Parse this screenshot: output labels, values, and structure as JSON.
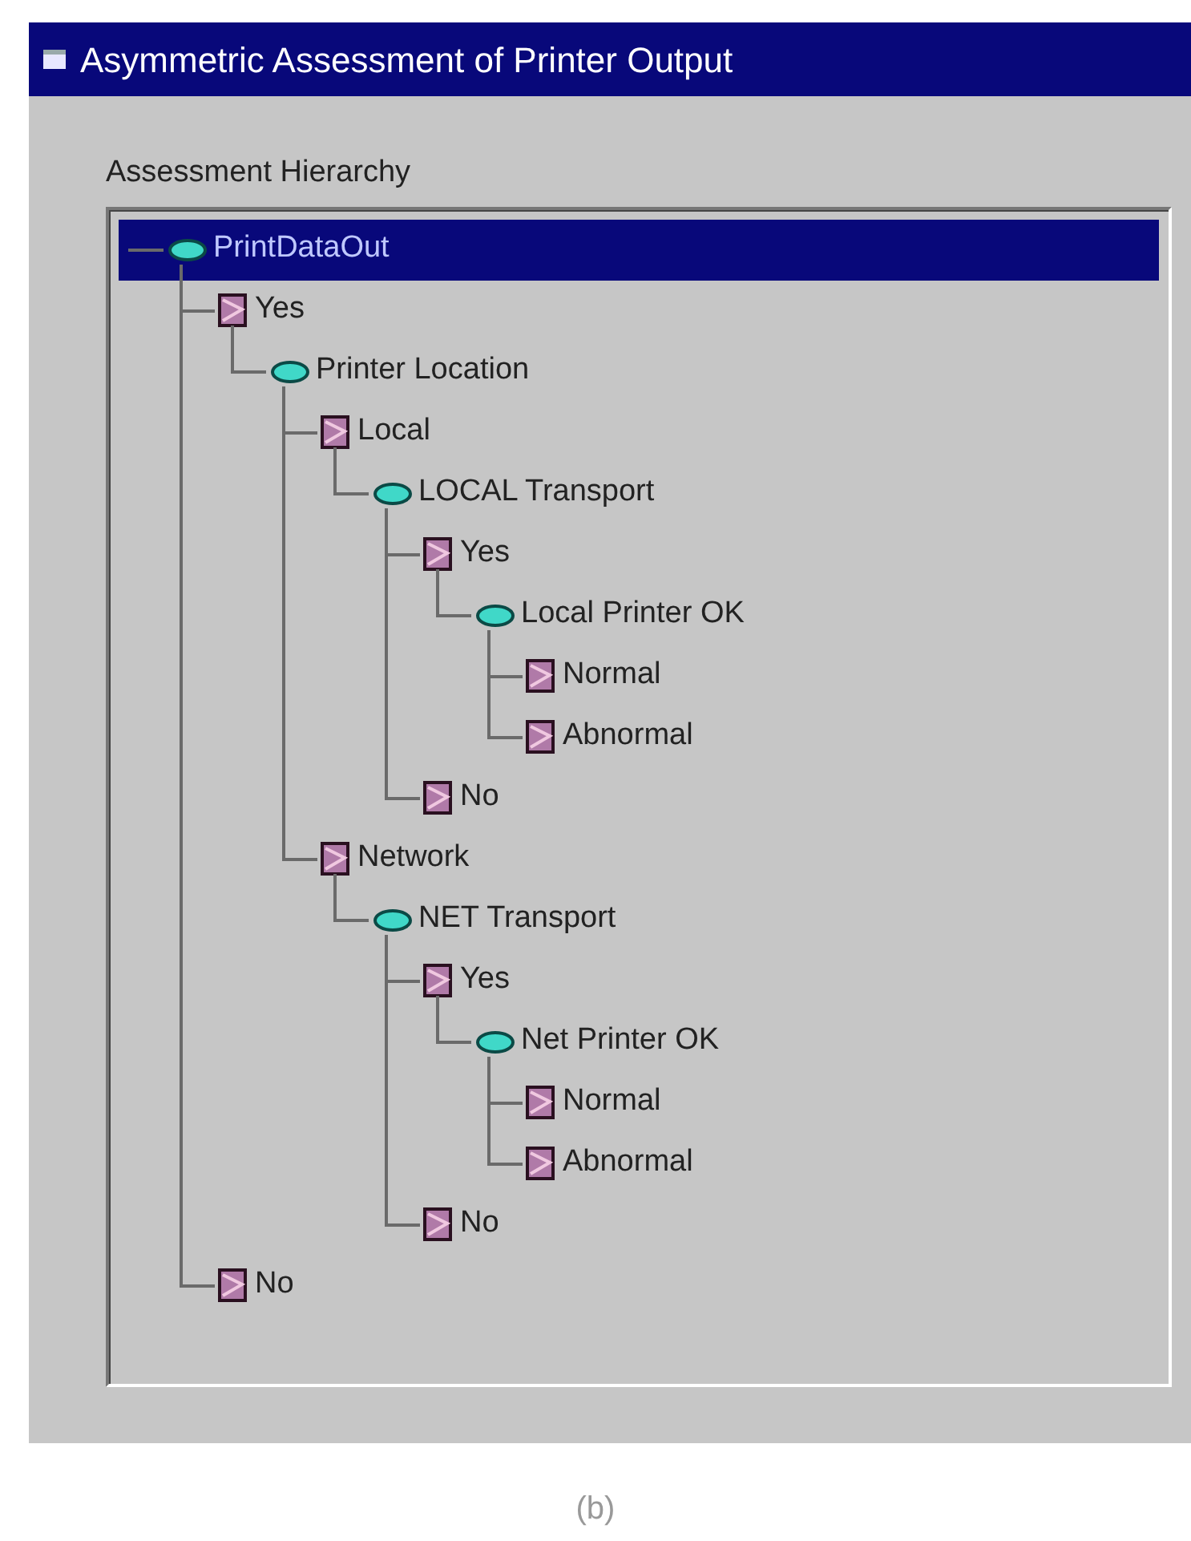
{
  "window": {
    "title": "Asymmetric Assessment of Printer Output"
  },
  "hierarchy": {
    "label": "Assessment Hierarchy",
    "tree": [
      {
        "label": "PrintDataOut",
        "kind": "variable",
        "selected": true,
        "children": [
          {
            "label": "Yes",
            "kind": "state",
            "selected": false,
            "children": [
              {
                "label": "Printer Location",
                "kind": "variable",
                "selected": false,
                "children": [
                  {
                    "label": "Local",
                    "kind": "state",
                    "selected": false,
                    "children": [
                      {
                        "label": "LOCAL Transport",
                        "kind": "variable",
                        "selected": false,
                        "children": [
                          {
                            "label": "Yes",
                            "kind": "state",
                            "selected": false,
                            "children": [
                              {
                                "label": "Local Printer OK",
                                "kind": "variable",
                                "selected": false,
                                "children": [
                                  {
                                    "label": "Normal",
                                    "kind": "state",
                                    "selected": false
                                  },
                                  {
                                    "label": "Abnormal",
                                    "kind": "state",
                                    "selected": false
                                  }
                                ]
                              }
                            ]
                          },
                          {
                            "label": "No",
                            "kind": "state",
                            "selected": false
                          }
                        ]
                      }
                    ]
                  },
                  {
                    "label": "Network",
                    "kind": "state",
                    "selected": false,
                    "children": [
                      {
                        "label": "NET Transport",
                        "kind": "variable",
                        "selected": false,
                        "children": [
                          {
                            "label": "Yes",
                            "kind": "state",
                            "selected": false,
                            "children": [
                              {
                                "label": "Net Printer OK",
                                "kind": "variable",
                                "selected": false,
                                "children": [
                                  {
                                    "label": "Normal",
                                    "kind": "state",
                                    "selected": false
                                  },
                                  {
                                    "label": "Abnormal",
                                    "kind": "state",
                                    "selected": false
                                  }
                                ]
                              }
                            ]
                          },
                          {
                            "label": "No",
                            "kind": "state",
                            "selected": false
                          }
                        ]
                      }
                    ]
                  }
                ]
              }
            ]
          },
          {
            "label": "No",
            "kind": "state",
            "selected": false
          }
        ]
      }
    ]
  },
  "caption": "(b)"
}
